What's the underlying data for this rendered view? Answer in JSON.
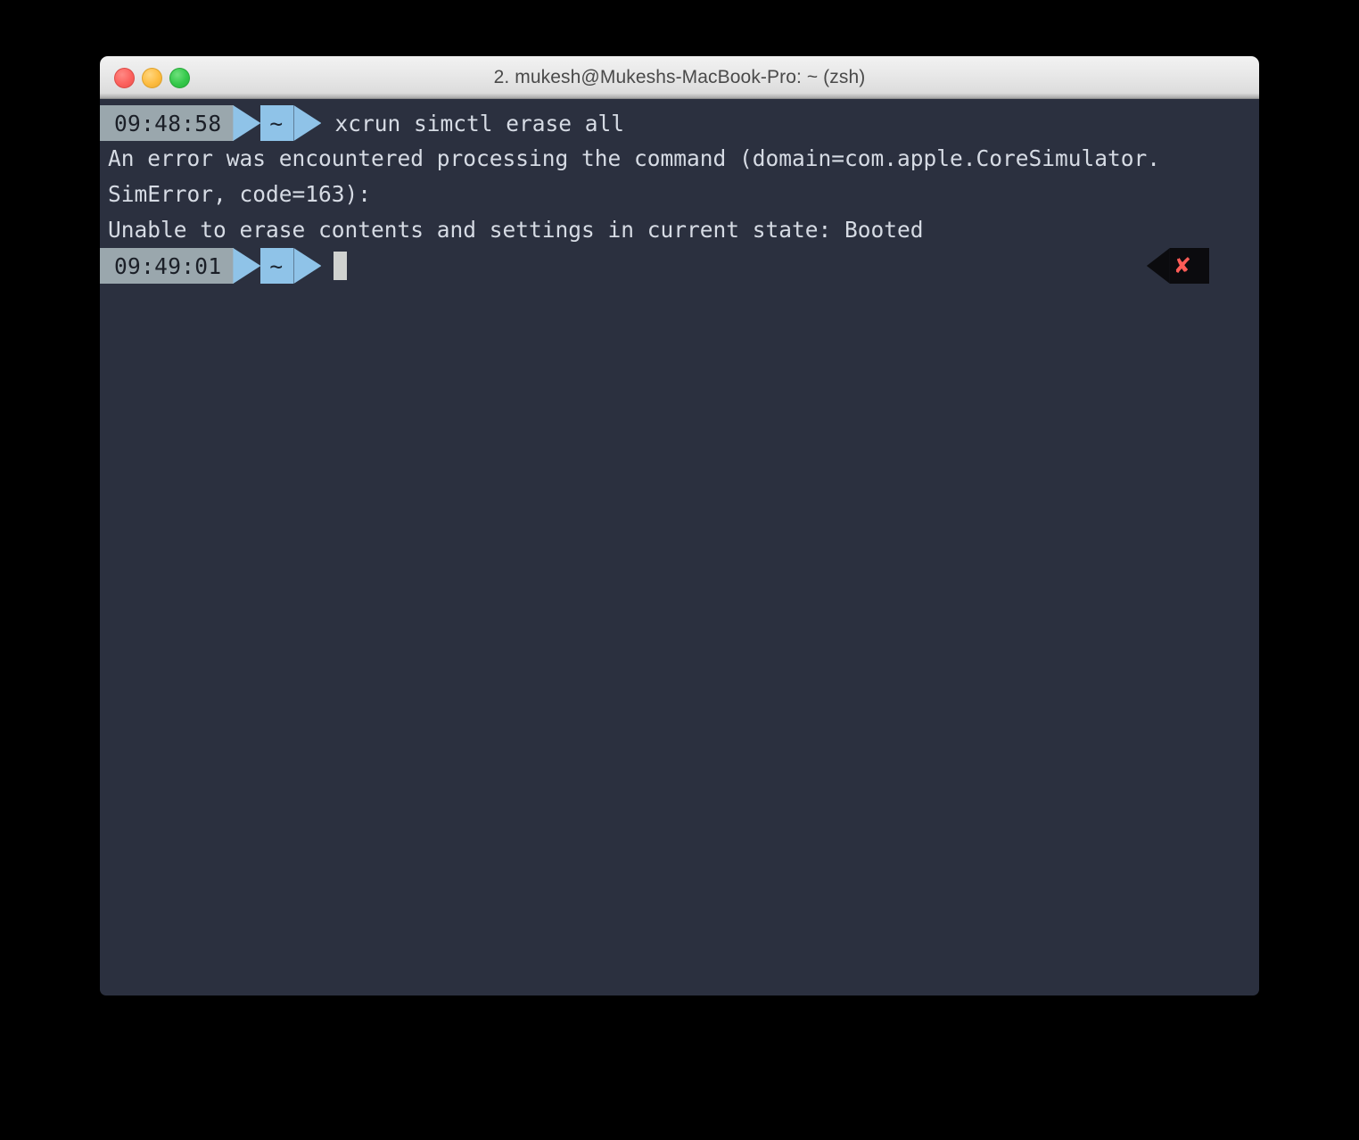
{
  "window": {
    "title": "2. mukesh@Mukeshs-MacBook-Pro: ~ (zsh)",
    "traffic_lights": {
      "close_label": "",
      "minimize_label": "",
      "zoom_label": "",
      "close_color": "#fc615d",
      "minimize_color": "#fdbc40",
      "zoom_color": "#34c84a"
    },
    "colors": {
      "desktop_background": "#000000",
      "titlebar_top": "#f2f2f2",
      "titlebar_bottom": "#a8a8a8",
      "title_text": "#4a4a4a",
      "terminal_background": "#2b303f",
      "terminal_text": "#d6dbe4",
      "prompt_time_background": "#9aa7ad",
      "prompt_time_text": "#1b1f27",
      "prompt_path_background": "#8fc3e8",
      "prompt_path_text": "#1b2430",
      "error_badge_background": "#0b0b0e",
      "error_badge_text": "#ff5c57",
      "cursor": "#d0d2d0"
    }
  },
  "terminal": {
    "prompt_first": {
      "time": "09:48:58",
      "path": "~",
      "command": "xcrun simctl erase all"
    },
    "output": [
      "An error was encountered processing the command (domain=com.apple.CoreSimulator.",
      "SimError, code=163):",
      "Unable to erase contents and settings in current state: Booted"
    ],
    "prompt_second": {
      "time": "09:49:01",
      "path": "~",
      "command": ""
    },
    "error_badge": {
      "symbol": "✘"
    }
  }
}
